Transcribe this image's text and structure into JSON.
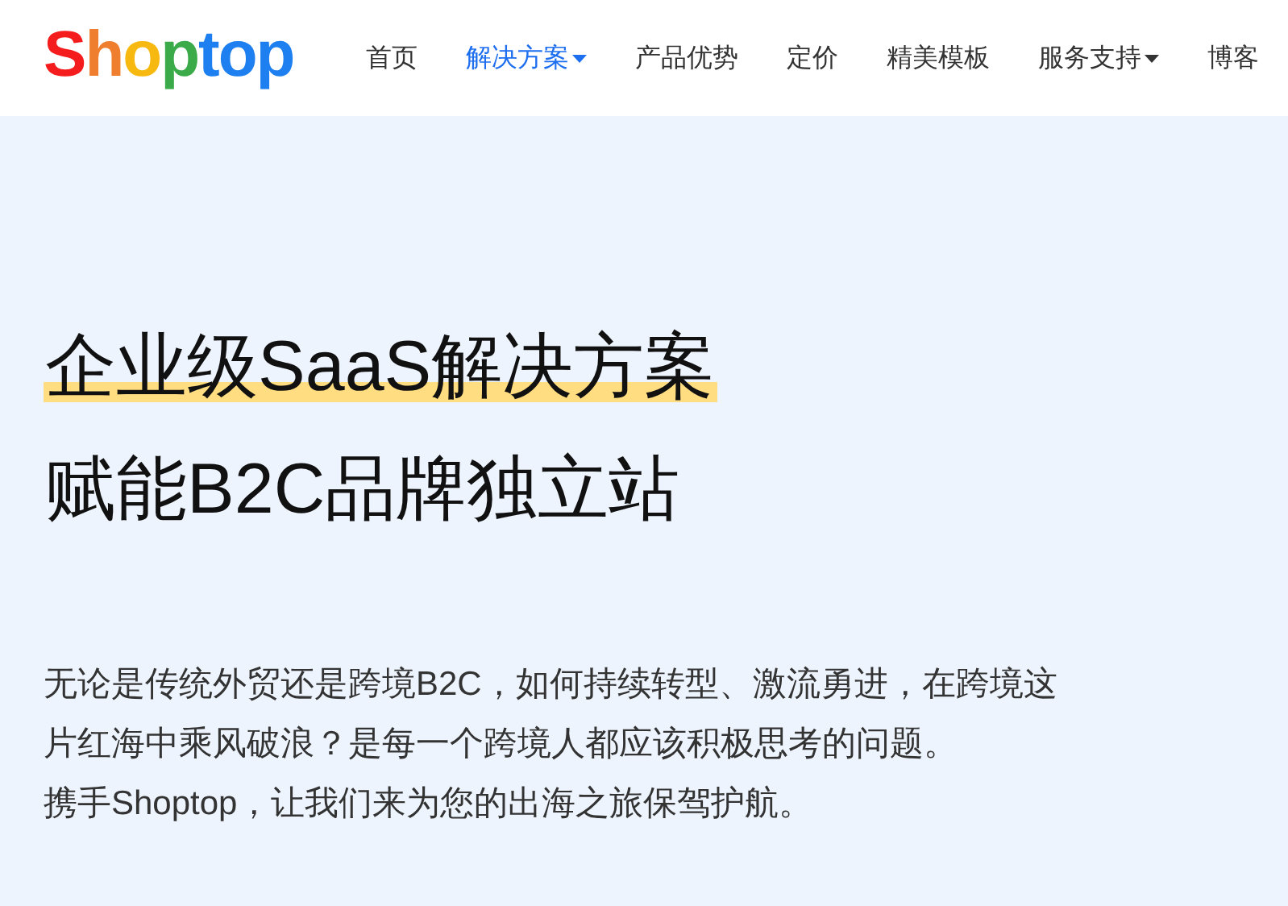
{
  "logo": {
    "letters": [
      {
        "text": "S",
        "color": "#f41c1c"
      },
      {
        "text": "h",
        "color": "#ef7f2f"
      },
      {
        "text": "o",
        "color": "#f7b90f"
      },
      {
        "text": "p",
        "color": "#3bab4a"
      },
      {
        "text": "t",
        "color": "#1e7ff0"
      },
      {
        "text": "o",
        "color": "#1e7ff0"
      },
      {
        "text": "p",
        "color": "#1e7ff0"
      }
    ]
  },
  "nav": [
    {
      "label": "首页",
      "selected": false,
      "has_dropdown": false
    },
    {
      "label": "解决方案",
      "selected": true,
      "has_dropdown": true
    },
    {
      "label": "产品优势",
      "selected": false,
      "has_dropdown": false
    },
    {
      "label": "定价",
      "selected": false,
      "has_dropdown": false
    },
    {
      "label": "精美模板",
      "selected": false,
      "has_dropdown": false
    },
    {
      "label": "服务支持",
      "selected": false,
      "has_dropdown": true
    },
    {
      "label": "博客",
      "selected": false,
      "has_dropdown": false
    }
  ],
  "hero": {
    "headline": [
      {
        "text": "企业级SaaS解决方案",
        "highlighted": true
      },
      {
        "text": "赋能B2C品牌独立站",
        "highlighted": false
      }
    ],
    "paragraphs": [
      "无论是传统外贸还是跨境B2C，如何持续转型、激流勇进，在跨境这片红海中乘风破浪？是每一个跨境人都应该积极思考的问题。",
      "携手Shoptop，让我们来为您的出海之旅保驾护航。"
    ]
  }
}
